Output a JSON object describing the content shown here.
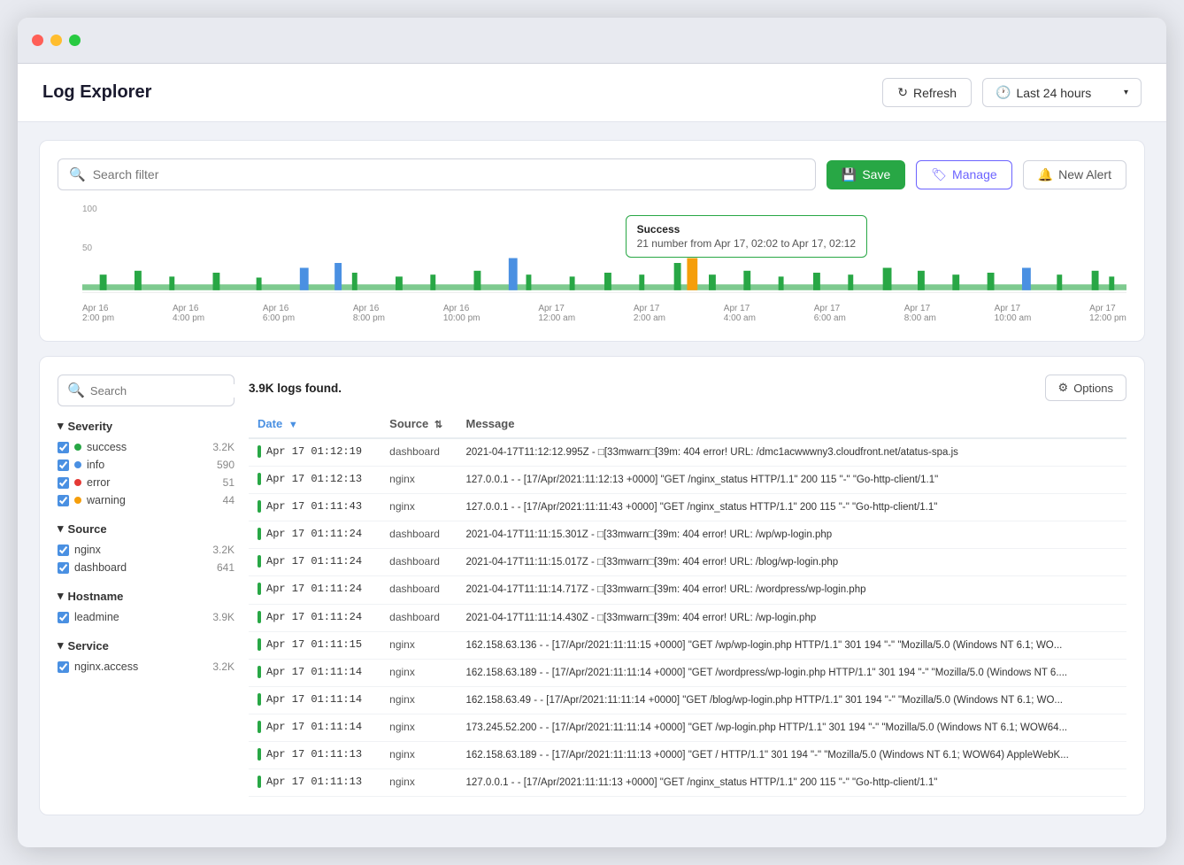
{
  "window": {
    "title": "Log Explorer"
  },
  "header": {
    "title": "Log Explorer",
    "refresh_label": "Refresh",
    "time_range": "Last 24 hours"
  },
  "toolbar": {
    "search_placeholder": "Search filter",
    "save_label": "Save",
    "manage_label": "Manage",
    "alert_label": "New Alert"
  },
  "chart": {
    "tooltip_title": "Success",
    "tooltip_sub": "21 number from Apr 17, 02:02 to Apr 17, 02:12",
    "y_labels": [
      "100",
      "50"
    ],
    "x_labels": [
      "Apr 16\n2:00 pm",
      "Apr 16\n4:00 pm",
      "Apr 16\n6:00 pm",
      "Apr 16\n8:00 pm",
      "Apr 16\n10:00 pm",
      "Apr 17\n12:00 am",
      "Apr 17\n2:00 am",
      "Apr 17\n4:00 am",
      "Apr 17\n6:00 am",
      "Apr 17\n8:00 am",
      "Apr 17\n10:00 am",
      "Apr 17\n12:00 pm"
    ]
  },
  "sidebar": {
    "search_placeholder": "Search",
    "filters": {
      "severity": {
        "title": "Severity",
        "items": [
          {
            "label": "success",
            "count": "3.2K",
            "color": "green",
            "checked": true
          },
          {
            "label": "info",
            "count": "590",
            "color": "blue",
            "checked": true
          },
          {
            "label": "error",
            "count": "51",
            "color": "red",
            "checked": true
          },
          {
            "label": "warning",
            "count": "44",
            "color": "yellow",
            "checked": true
          }
        ]
      },
      "source": {
        "title": "Source",
        "items": [
          {
            "label": "nginx",
            "count": "3.2K",
            "checked": true
          },
          {
            "label": "dashboard",
            "count": "641",
            "checked": true
          }
        ]
      },
      "hostname": {
        "title": "Hostname",
        "items": [
          {
            "label": "leadmine",
            "count": "3.9K",
            "checked": true
          }
        ]
      },
      "service": {
        "title": "Service",
        "items": [
          {
            "label": "nginx.access",
            "count": "3.2K",
            "checked": true
          }
        ]
      }
    }
  },
  "table": {
    "logs_count": "3.9K logs found.",
    "options_label": "Options",
    "columns": [
      "Date",
      "Source",
      "Message"
    ],
    "rows": [
      {
        "date": "Apr 17 01:12:19",
        "source": "dashboard",
        "message": "2021-04-17T11:12:12.995Z - □[33mwarn□[39m: 404 error! URL: /dmc1acwwwny3.cloudfront.net/atatus-spa.js",
        "severity": "green"
      },
      {
        "date": "Apr 17 01:12:13",
        "source": "nginx",
        "message": "127.0.0.1 - - [17/Apr/2021:11:12:13 +0000] \"GET /nginx_status HTTP/1.1\" 200 115 \"-\" \"Go-http-client/1.1\"",
        "severity": "green"
      },
      {
        "date": "Apr 17 01:11:43",
        "source": "nginx",
        "message": "127.0.0.1 - - [17/Apr/2021:11:11:43 +0000] \"GET /nginx_status HTTP/1.1\" 200 115 \"-\" \"Go-http-client/1.1\"",
        "severity": "green"
      },
      {
        "date": "Apr 17 01:11:24",
        "source": "dashboard",
        "message": "2021-04-17T11:11:15.301Z - □[33mwarn□[39m: 404 error! URL: /wp/wp-login.php",
        "severity": "green"
      },
      {
        "date": "Apr 17 01:11:24",
        "source": "dashboard",
        "message": "2021-04-17T11:11:15.017Z - □[33mwarn□[39m: 404 error! URL: /blog/wp-login.php",
        "severity": "green"
      },
      {
        "date": "Apr 17 01:11:24",
        "source": "dashboard",
        "message": "2021-04-17T11:11:14.717Z - □[33mwarn□[39m: 404 error! URL: /wordpress/wp-login.php",
        "severity": "green"
      },
      {
        "date": "Apr 17 01:11:24",
        "source": "dashboard",
        "message": "2021-04-17T11:11:14.430Z - □[33mwarn□[39m: 404 error! URL: /wp-login.php",
        "severity": "green"
      },
      {
        "date": "Apr 17 01:11:15",
        "source": "nginx",
        "message": "162.158.63.136 - - [17/Apr/2021:11:11:15 +0000] \"GET /wp/wp-login.php HTTP/1.1\" 301 194 \"-\" \"Mozilla/5.0 (Windows NT 6.1; WO...",
        "severity": "green"
      },
      {
        "date": "Apr 17 01:11:14",
        "source": "nginx",
        "message": "162.158.63.189 - - [17/Apr/2021:11:11:14 +0000] \"GET /wordpress/wp-login.php HTTP/1.1\" 301 194 \"-\" \"Mozilla/5.0 (Windows NT 6....",
        "severity": "green"
      },
      {
        "date": "Apr 17 01:11:14",
        "source": "nginx",
        "message": "162.158.63.49 - - [17/Apr/2021:11:11:14 +0000] \"GET /blog/wp-login.php HTTP/1.1\" 301 194 \"-\" \"Mozilla/5.0 (Windows NT 6.1; WO...",
        "severity": "green"
      },
      {
        "date": "Apr 17 01:11:14",
        "source": "nginx",
        "message": "173.245.52.200 - - [17/Apr/2021:11:11:14 +0000] \"GET /wp-login.php HTTP/1.1\" 301 194 \"-\" \"Mozilla/5.0 (Windows NT 6.1; WOW64...",
        "severity": "green"
      },
      {
        "date": "Apr 17 01:11:13",
        "source": "nginx",
        "message": "162.158.63.189 - - [17/Apr/2021:11:11:13 +0000] \"GET / HTTP/1.1\" 301 194 \"-\" \"Mozilla/5.0 (Windows NT 6.1; WOW64) AppleWebK...",
        "severity": "green"
      },
      {
        "date": "Apr 17 01:11:13",
        "source": "nginx",
        "message": "127.0.0.1 - - [17/Apr/2021:11:11:13 +0000] \"GET /nginx_status HTTP/1.1\" 200 115 \"-\" \"Go-http-client/1.1\"",
        "severity": "green"
      }
    ]
  }
}
